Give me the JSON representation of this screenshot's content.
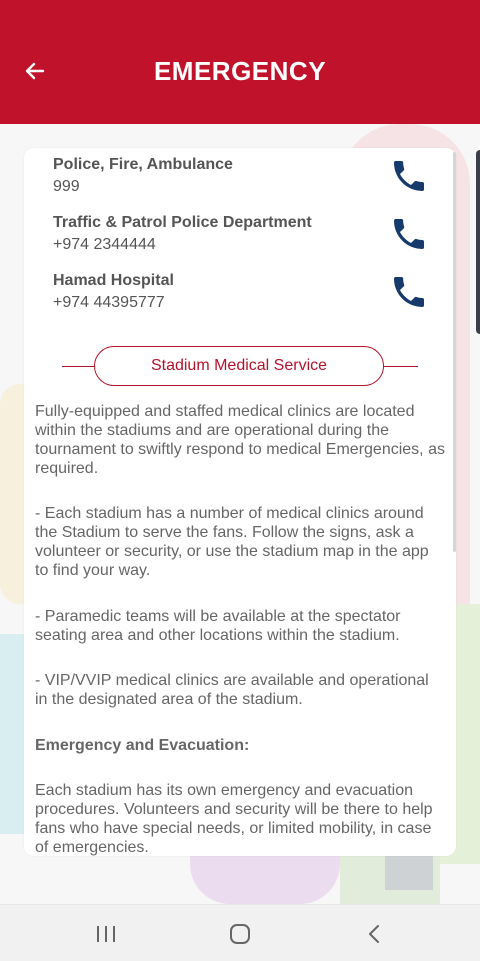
{
  "header": {
    "title": "EMERGENCY",
    "back_icon": "arrow-left-icon",
    "background_color": "#c1122b"
  },
  "contacts": [
    {
      "name": "Police, Fire, Ambulance",
      "number": "999",
      "icon": "phone-icon"
    },
    {
      "name": "Traffic & Patrol Police Department",
      "number": "+974 2344444",
      "icon": "phone-icon"
    },
    {
      "name": "Hamad Hospital",
      "number": "+974 44395777",
      "icon": "phone-icon"
    }
  ],
  "section": {
    "title": "Stadium Medical Service",
    "accent_color": "#b5122b"
  },
  "paragraphs": [
    "Fully-equipped and staffed medical clinics are located within the stadiums and are operational during the tournament to swiftly respond to medical Emergencies, as required.",
    "- Each stadium has a number of medical clinics around the Stadium to serve the fans. Follow the signs, ask a volunteer or security, or use the stadium map in the app to find your way.",
    "- Paramedic teams will be available at the spectator seating area and other locations within the stadium.",
    "- VIP/VVIP medical clinics are available and operational in the designated area of the stadium.",
    "Emergency and Evacuation:",
    "Each stadium has its own emergency and evacuation procedures. Volunteers and security will be there to help fans who have special needs, or limited mobility, in case of emergencies."
  ],
  "navbar": {
    "recent_icon": "recent-apps-icon",
    "home_icon": "home-icon",
    "back_icon": "back-chevron-icon"
  },
  "colors": {
    "phone_icon": "#163a6b",
    "body_text": "#666666"
  }
}
